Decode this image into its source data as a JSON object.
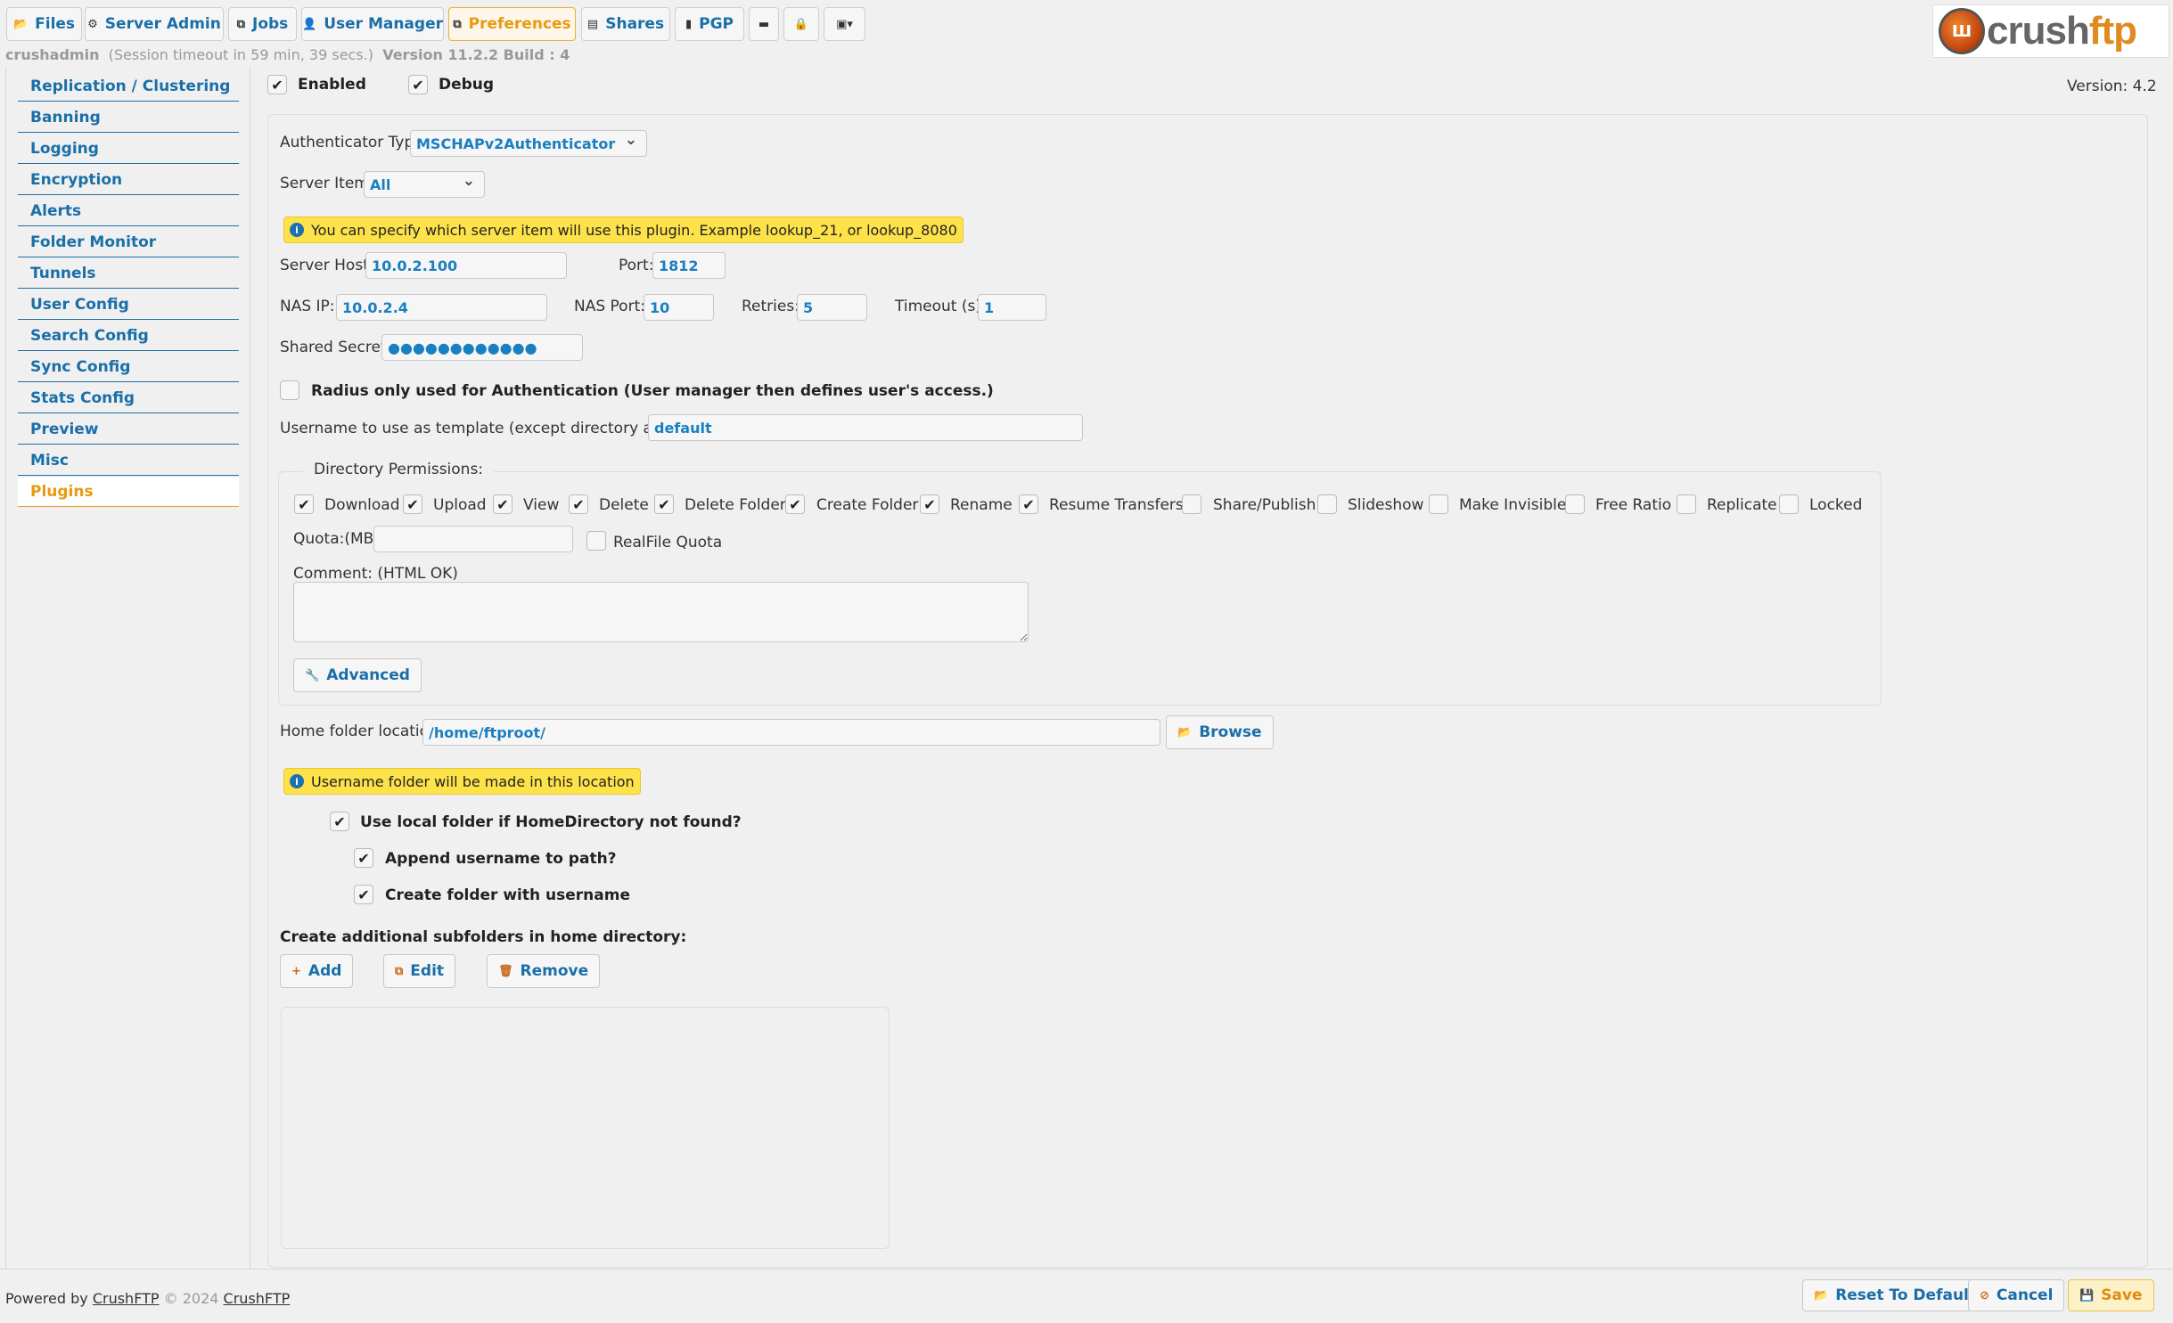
{
  "tabs": [
    {
      "label": "Files",
      "icon": "folder-open-icon"
    },
    {
      "label": "Server Admin",
      "icon": "gear-icon"
    },
    {
      "label": "Jobs",
      "icon": "jobs-icon"
    },
    {
      "label": "User Manager",
      "icon": "user-icon"
    },
    {
      "label": "Preferences",
      "icon": "preferences-icon"
    },
    {
      "label": "Shares",
      "icon": "shares-icon"
    },
    {
      "label": "PGP",
      "icon": "pgp-icon"
    }
  ],
  "icon_tabs": [
    "terminal-icon",
    "lock-icon",
    "image-dropdown-icon"
  ],
  "session": {
    "user": "crushadmin",
    "timeout": "(Session timeout in 59 min, 39 secs.)",
    "version": "Version 11.2.2 Build : 4"
  },
  "logo": {
    "text_a": "crush",
    "text_b": "ftp"
  },
  "sidebar": {
    "items": [
      "Replication / Clustering",
      "Banning",
      "Logging",
      "Encryption",
      "Alerts",
      "Folder Monitor",
      "Tunnels",
      "User Config",
      "Search Config",
      "Sync Config",
      "Stats Config",
      "Preview",
      "Misc",
      "Plugins"
    ],
    "active": "Plugins"
  },
  "plugin": {
    "enabled_label": "Enabled",
    "enabled": true,
    "debug_label": "Debug",
    "debug": true,
    "version": "Version: 4.2"
  },
  "form": {
    "authenticator_label": "Authenticator Type:",
    "authenticator_value": "MSCHAPv2Authenticator",
    "server_item_label": "Server Item:",
    "server_item_value": "All",
    "server_item_notice": "You can specify which server item will use this plugin. Example lookup_21, or lookup_8080",
    "server_host_label": "Server Host:",
    "server_host_value": "10.0.2.100",
    "port_label": "Port:",
    "port_value": "1812",
    "nas_ip_label": "NAS IP:",
    "nas_ip_value": "10.0.2.4",
    "nas_port_label": "NAS Port:",
    "nas_port_value": "10",
    "retries_label": "Retries:",
    "retries_value": "5",
    "timeout_label": "Timeout (s):",
    "timeout_value": "1",
    "shared_secret_label": "Shared Secret:",
    "shared_secret_value": "●●●●●●●●●●●●",
    "radius_only_label": "Radius only used for Authentication (User manager then defines user's access.)",
    "radius_only": false,
    "template_label": "Username to use as template (except directory access):",
    "template_value": "default"
  },
  "dir_permissions": {
    "legend": "Directory Permissions:",
    "items": [
      {
        "label": "Download",
        "checked": true
      },
      {
        "label": "Upload",
        "checked": true
      },
      {
        "label": "View",
        "checked": true
      },
      {
        "label": "Delete",
        "checked": true
      },
      {
        "label": "Delete Folder",
        "checked": true
      },
      {
        "label": "Create Folder",
        "checked": true
      },
      {
        "label": "Rename",
        "checked": true
      },
      {
        "label": "Resume Transfers",
        "checked": true
      },
      {
        "label": "Share/Publish",
        "checked": false
      },
      {
        "label": "Slideshow",
        "checked": false
      },
      {
        "label": "Make Invisible",
        "checked": false
      },
      {
        "label": "Free Ratio",
        "checked": false
      },
      {
        "label": "Replicate",
        "checked": false
      },
      {
        "label": "Locked",
        "checked": false
      }
    ],
    "quota_label": "Quota:(MB)",
    "quota_value": "",
    "realfile_quota_label": "RealFile Quota",
    "realfile_quota": false,
    "comment_label": "Comment: (HTML OK)",
    "comment_value": "",
    "advanced_button": "Advanced"
  },
  "home": {
    "label": "Home folder location:",
    "value": "/home/ftproot/",
    "browse_button": "Browse",
    "notice": "Username folder will be made in this location",
    "use_local_label": "Use local folder if HomeDirectory not found?",
    "use_local": true,
    "append_label": "Append username to path?",
    "append": true,
    "create_label": "Create folder with username",
    "create": true
  },
  "subfolders": {
    "label": "Create additional subfolders in home directory:",
    "add_button": "Add",
    "edit_button": "Edit",
    "remove_button": "Remove"
  },
  "footer": {
    "powered_prefix": "Powered by",
    "powered_link": "CrushFTP",
    "copyright": "© 2024",
    "company_link": "CrushFTP",
    "reset_button": "Reset To Default",
    "cancel_button": "Cancel",
    "save_button": "Save"
  },
  "colors": {
    "link_blue": "#1a6fa8",
    "active_orange": "#e89a12",
    "notice_yellow": "#fde24a"
  }
}
